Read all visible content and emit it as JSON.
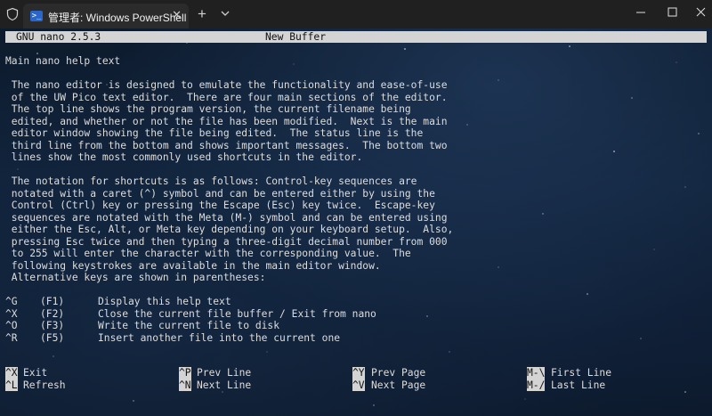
{
  "window": {
    "tab_title": "管理者: Windows PowerShell",
    "tab_icon": "powershell-icon",
    "new_tab": "+",
    "close_tab": "✕"
  },
  "nano": {
    "version": "GNU nano 2.5.3",
    "buffer": "New Buffer",
    "help_title": "Main nano help text",
    "paragraph1": [
      " The nano editor is designed to emulate the functionality and ease-of-use",
      " of the UW Pico text editor.  There are four main sections of the editor.",
      " The top line shows the program version, the current filename being",
      " edited, and whether or not the file has been modified.  Next is the main",
      " editor window showing the file being edited.  The status line is the",
      " third line from the bottom and shows important messages.  The bottom two",
      " lines show the most commonly used shortcuts in the editor."
    ],
    "paragraph2": [
      " The notation for shortcuts is as follows: Control-key sequences are",
      " notated with a caret (^) symbol and can be entered either by using the",
      " Control (Ctrl) key or pressing the Escape (Esc) key twice.  Escape-key",
      " sequences are notated with the Meta (M-) symbol and can be entered using",
      " either the Esc, Alt, or Meta key depending on your keyboard setup.  Also,",
      " pressing Esc twice and then typing a three-digit decimal number from 000",
      " to 255 will enter the character with the corresponding value.  The",
      " following keystrokes are available in the main editor window.",
      " Alternative keys are shown in parentheses:"
    ],
    "keystrokes": [
      {
        "key": "^G",
        "alt": "(F1)",
        "desc": "Display this help text"
      },
      {
        "key": "^X",
        "alt": "(F2)",
        "desc": "Close the current file buffer / Exit from nano"
      },
      {
        "key": "^O",
        "alt": "(F3)",
        "desc": "Write the current file to disk"
      },
      {
        "key": "^R",
        "alt": "(F5)",
        "desc": "Insert another file into the current one"
      }
    ],
    "shortcuts": [
      {
        "key": "^X",
        "label": "Exit"
      },
      {
        "key": "^L",
        "label": "Refresh"
      },
      {
        "key": "^P",
        "label": "Prev Line"
      },
      {
        "key": "^N",
        "label": "Next Line"
      },
      {
        "key": "^Y",
        "label": "Prev Page"
      },
      {
        "key": "^V",
        "label": "Next Page"
      },
      {
        "key": "M-\\",
        "label": "First Line"
      },
      {
        "key": "M-/",
        "label": "Last Line"
      }
    ]
  },
  "colors": {
    "titlebar": "#202020",
    "tab": "#2b2b2b",
    "terminal_text": "#dddddd",
    "highlight": "#d4d4d4"
  }
}
